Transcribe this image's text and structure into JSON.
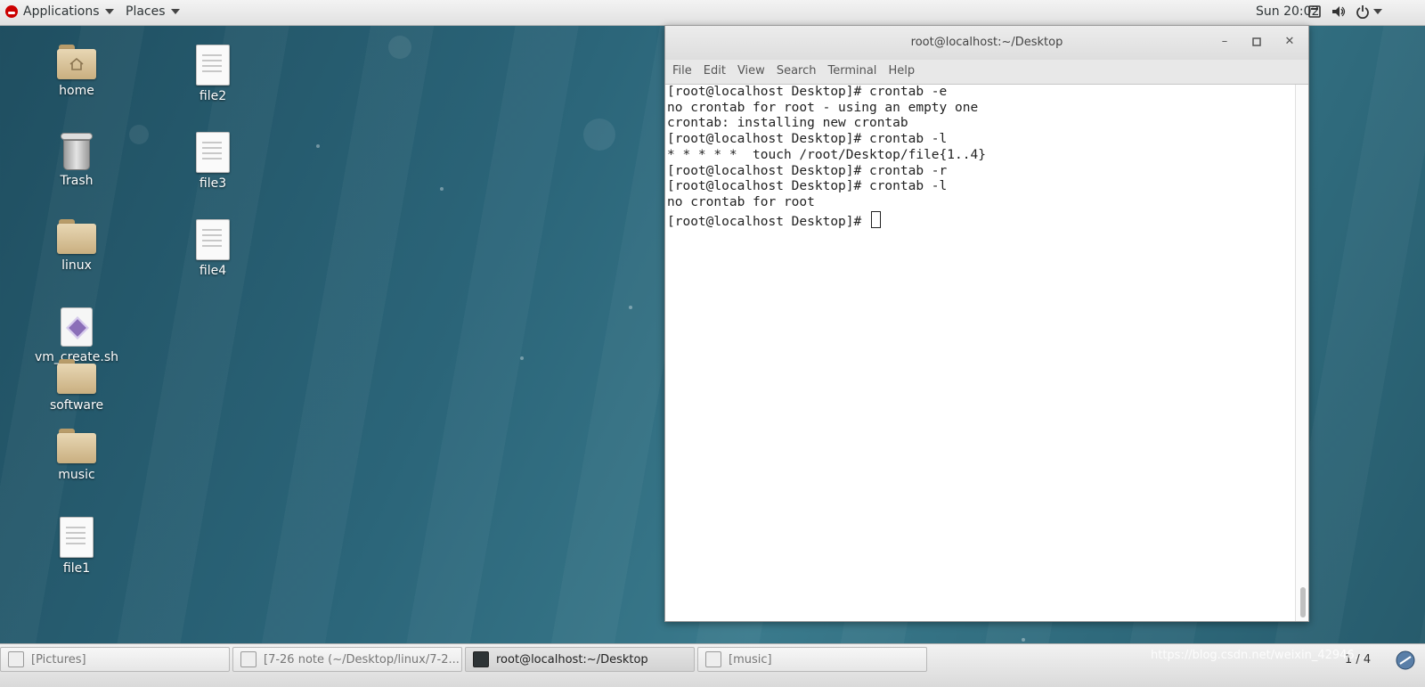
{
  "topbar": {
    "applications_label": "Applications",
    "places_label": "Places",
    "clock": "Sun 20:02"
  },
  "desktop": {
    "icons": [
      {
        "label": "home",
        "kind": "folder-home"
      },
      {
        "label": "Trash",
        "kind": "trash"
      },
      {
        "label": "linux",
        "kind": "folder"
      },
      {
        "label": "vm_create.sh",
        "kind": "script"
      },
      {
        "label": "software",
        "kind": "folder"
      },
      {
        "label": "music",
        "kind": "folder"
      },
      {
        "label": "file1",
        "kind": "document"
      },
      {
        "label": "file2",
        "kind": "document"
      },
      {
        "label": "file3",
        "kind": "document"
      },
      {
        "label": "file4",
        "kind": "document"
      }
    ]
  },
  "terminal": {
    "title": "root@localhost:~/Desktop",
    "menu": [
      "File",
      "Edit",
      "View",
      "Search",
      "Terminal",
      "Help"
    ],
    "lines": [
      "[root@localhost Desktop]# crontab -e",
      "no crontab for root - using an empty one",
      "crontab: installing new crontab",
      "[root@localhost Desktop]# crontab -l",
      "* * * * *  touch /root/Desktop/file{1..4}",
      "[root@localhost Desktop]# crontab -r",
      "[root@localhost Desktop]# crontab -l",
      "no crontab for root",
      "[root@localhost Desktop]# "
    ]
  },
  "taskbar": {
    "tasks": [
      {
        "label": "[Pictures]",
        "active": false
      },
      {
        "label": "[7-26 note (~/Desktop/linux/7-2...",
        "active": false
      },
      {
        "label": "root@localhost:~/Desktop",
        "active": true
      },
      {
        "label": "[music]",
        "active": false
      }
    ],
    "pager": "1 / 4"
  },
  "watermark": "https://blog.csdn.net/weixin_42946..."
}
